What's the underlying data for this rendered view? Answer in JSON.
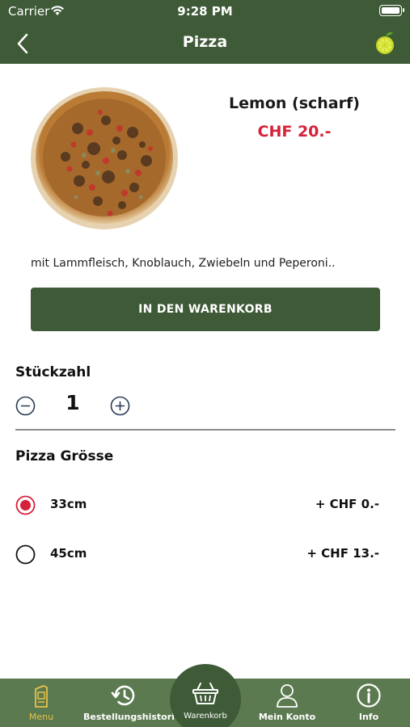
{
  "status": {
    "carrier": "Carrier",
    "time": "9:28 PM"
  },
  "nav": {
    "title": "Pizza"
  },
  "product": {
    "name": "Lemon (scharf)",
    "price": "CHF 20.-",
    "description": "mit Lammfleisch, Knoblauch, Zwiebeln und Peperoni.."
  },
  "cart_button": {
    "label": "IN DEN WARENKORB"
  },
  "quantity": {
    "label": "Stückzahl",
    "value": "1"
  },
  "size": {
    "label": "Pizza Grösse",
    "options": [
      {
        "name": "33cm",
        "price": "+ CHF 0.-",
        "selected": true
      },
      {
        "name": "45cm",
        "price": "+ CHF 13.-",
        "selected": false
      }
    ]
  },
  "tabs": [
    {
      "label": "Menu",
      "icon": "menu-icon",
      "active": true
    },
    {
      "label": "Bestellungshistorie",
      "icon": "history-icon",
      "active": false
    },
    {
      "label": "Warenkorb",
      "icon": "basket-icon",
      "active": false
    },
    {
      "label": "Mein Konto",
      "icon": "user-icon",
      "active": false
    },
    {
      "label": "Info",
      "icon": "info-icon",
      "active": false
    }
  ],
  "colors": {
    "header": "#3f5a37",
    "tabbar": "#5b7a50",
    "price": "#d6213b",
    "active_tab": "#e8c24a"
  }
}
